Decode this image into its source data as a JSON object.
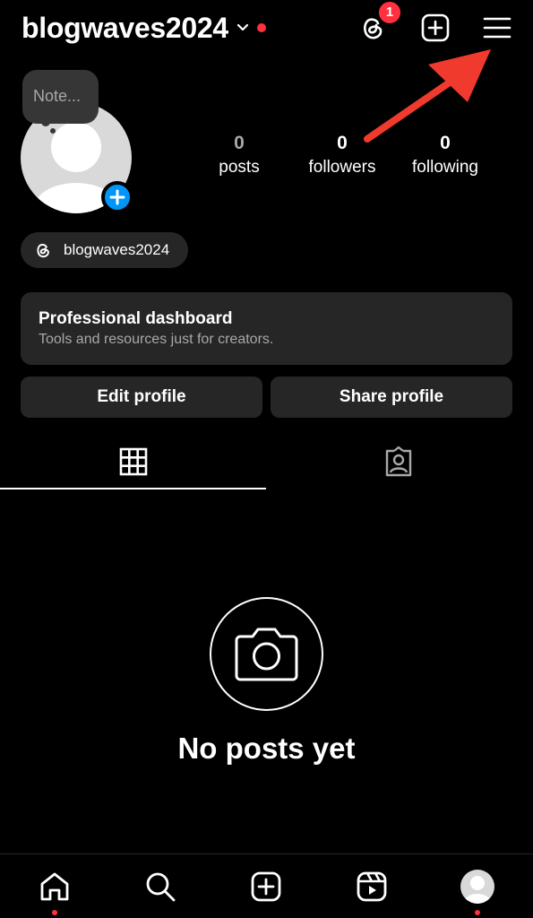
{
  "header": {
    "username": "blogwaves2024",
    "threads_badge_count": "1"
  },
  "note": {
    "placeholder": "Note..."
  },
  "stats": [
    {
      "value": "0",
      "label": "posts"
    },
    {
      "value": "0",
      "label": "followers"
    },
    {
      "value": "0",
      "label": "following"
    }
  ],
  "threads_link": {
    "handle": "blogwaves2024"
  },
  "professional_dashboard": {
    "title": "Professional dashboard",
    "subtitle": "Tools and resources just for creators."
  },
  "buttons": {
    "edit_profile": "Edit profile",
    "share_profile": "Share profile"
  },
  "tabs": [
    {
      "icon": "grid-icon",
      "active": true
    },
    {
      "icon": "tagged-icon",
      "active": false
    }
  ],
  "empty_state": {
    "icon": "camera-icon",
    "title": "No posts yet"
  },
  "bottom_nav": [
    {
      "icon": "home-icon",
      "notification_dot": true
    },
    {
      "icon": "search-icon",
      "notification_dot": false
    },
    {
      "icon": "create-icon",
      "notification_dot": false
    },
    {
      "icon": "reels-icon",
      "notification_dot": false
    },
    {
      "icon": "profile-avatar",
      "notification_dot": true
    }
  ],
  "colors": {
    "background": "#000000",
    "surface": "#262626",
    "accent_blue": "#0095f6",
    "notification_red": "#ff3040",
    "annotation_arrow": "#f03a2e",
    "muted_text": "#a8a8a8"
  }
}
